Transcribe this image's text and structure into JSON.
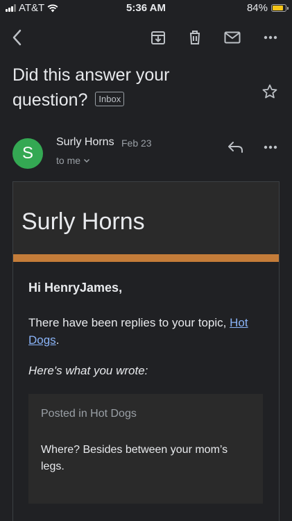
{
  "status_bar": {
    "carrier": "AT&T",
    "time": "5:36 AM",
    "battery_percent": "84%",
    "battery_level": 0.84,
    "signal_bars_active": 3,
    "battery_color": "#f5c518"
  },
  "toolbar": {
    "icons": [
      "back-arrow-icon",
      "archive-icon",
      "trash-icon",
      "mail-icon",
      "more-icon"
    ]
  },
  "subject": {
    "title": "Did this answer your question?",
    "label": "Inbox"
  },
  "message": {
    "sender_initial": "S",
    "sender_name": "Surly Horns",
    "date": "Feb 23",
    "recipient": "to me",
    "avatar_color": "#34a853"
  },
  "email": {
    "brand_name": "Surly Horns",
    "brand_color": "#c47c39",
    "greeting": "Hi HenryJames,",
    "intro_text": "There have been replies to your topic, ",
    "topic_link": "Hot Dogs",
    "intro_end": ".",
    "wrote_label": "Here's what you wrote:",
    "posted_in": "Posted in Hot Dogs",
    "quoted_text": "Where? Besides between your mom’s legs."
  }
}
